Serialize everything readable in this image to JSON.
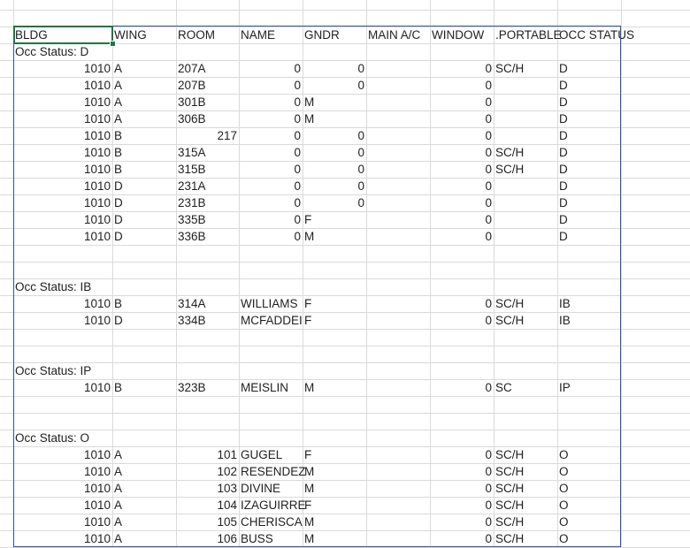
{
  "header": [
    "BLDG",
    "WING",
    "ROOM",
    "NAME",
    "GNDR",
    "MAIN A/C",
    "WINDOW",
    ".PORTABLE",
    "OCC STATUS"
  ],
  "rows": [
    {
      "type": "group",
      "label": "Occ Status: D"
    },
    {
      "type": "data",
      "bldg": "1010",
      "wing": "A",
      "room": "207A",
      "name": "0",
      "gndr": "0",
      "main_ac": "0",
      "window": "SC/H",
      "occ": "D"
    },
    {
      "type": "data",
      "bldg": "1010",
      "wing": "A",
      "room": "207B",
      "name": "0",
      "gndr": "0",
      "main_ac": "0",
      "occ": "D"
    },
    {
      "type": "data",
      "bldg": "1010",
      "wing": "A",
      "room": "301B",
      "name": "0",
      "gndr": "M",
      "main_ac": "0",
      "occ": "D"
    },
    {
      "type": "data",
      "bldg": "1010",
      "wing": "A",
      "room": "306B",
      "name": "0",
      "gndr": "M",
      "main_ac": "0",
      "occ": "D"
    },
    {
      "type": "data",
      "bldg": "1010",
      "wing": "B",
      "room_num": "217",
      "name": "0",
      "gndr": "0",
      "main_ac": "0",
      "occ": "D"
    },
    {
      "type": "data",
      "bldg": "1010",
      "wing": "B",
      "room": "315A",
      "name": "0",
      "gndr": "0",
      "main_ac": "0",
      "window": "SC/H",
      "occ": "D"
    },
    {
      "type": "data",
      "bldg": "1010",
      "wing": "B",
      "room": "315B",
      "name": "0",
      "gndr": "0",
      "main_ac": "0",
      "window": "SC/H",
      "occ": "D"
    },
    {
      "type": "data",
      "bldg": "1010",
      "wing": "D",
      "room": "231A",
      "name": "0",
      "gndr": "0",
      "main_ac": "0",
      "occ": "D"
    },
    {
      "type": "data",
      "bldg": "1010",
      "wing": "D",
      "room": "231B",
      "name": "0",
      "gndr": "0",
      "main_ac": "0",
      "occ": "D"
    },
    {
      "type": "data",
      "bldg": "1010",
      "wing": "D",
      "room": "335B",
      "name": "0",
      "gndr": "F",
      "main_ac": "0",
      "occ": "D"
    },
    {
      "type": "data",
      "bldg": "1010",
      "wing": "D",
      "room": "336B",
      "name": "0",
      "gndr": "M",
      "main_ac": "0",
      "occ": "D"
    },
    {
      "type": "blank"
    },
    {
      "type": "blank"
    },
    {
      "type": "group",
      "label": "Occ Status: IB"
    },
    {
      "type": "data",
      "bldg": "1010",
      "wing": "B",
      "room": "314A",
      "name": "WILLIAMS",
      "gndr": "F",
      "main_ac": "0",
      "window": "SC/H",
      "occ": "IB"
    },
    {
      "type": "data",
      "bldg": "1010",
      "wing": "D",
      "room": "334B",
      "name": "MCFADDEI",
      "gndr": "F",
      "main_ac": "0",
      "window": "SC/H",
      "occ": "IB"
    },
    {
      "type": "blank"
    },
    {
      "type": "blank"
    },
    {
      "type": "group",
      "label": "Occ Status: IP"
    },
    {
      "type": "data",
      "bldg": "1010",
      "wing": "B",
      "room": "323B",
      "name": "MEISLIN",
      "gndr": "M",
      "main_ac": "0",
      "window": "SC",
      "occ": "IP"
    },
    {
      "type": "blank"
    },
    {
      "type": "blank"
    },
    {
      "type": "group",
      "label": "Occ Status: O"
    },
    {
      "type": "data",
      "bldg": "1010",
      "wing": "A",
      "room_num": "101",
      "name": "GUGEL",
      "gndr": "F",
      "main_ac": "0",
      "window": "SC/H",
      "occ": "O"
    },
    {
      "type": "data",
      "bldg": "1010",
      "wing": "A",
      "room_num": "102",
      "name": "RESENDEZ",
      "gndr": "M",
      "main_ac": "0",
      "window": "SC/H",
      "occ": "O"
    },
    {
      "type": "data",
      "bldg": "1010",
      "wing": "A",
      "room_num": "103",
      "name": "DIVINE",
      "gndr": "M",
      "main_ac": "0",
      "window": "SC/H",
      "occ": "O"
    },
    {
      "type": "data",
      "bldg": "1010",
      "wing": "A",
      "room_num": "104",
      "name": "IZAGUIRRE",
      "gndr": "F",
      "main_ac": "0",
      "window": "SC/H",
      "occ": "O"
    },
    {
      "type": "data",
      "bldg": "1010",
      "wing": "A",
      "room_num": "105",
      "name": "CHERISCA",
      "gndr": "M",
      "main_ac": "0",
      "window": "SC/H",
      "occ": "O"
    },
    {
      "type": "data",
      "bldg": "1010",
      "wing": "A",
      "room_num": "106",
      "name": "BUSS",
      "gndr": "M",
      "main_ac": "0",
      "window": "SC/H",
      "occ": "O"
    }
  ],
  "colors": {
    "gridline": "#dadada",
    "selection": "#2a52be",
    "active_cell": "#217346"
  }
}
